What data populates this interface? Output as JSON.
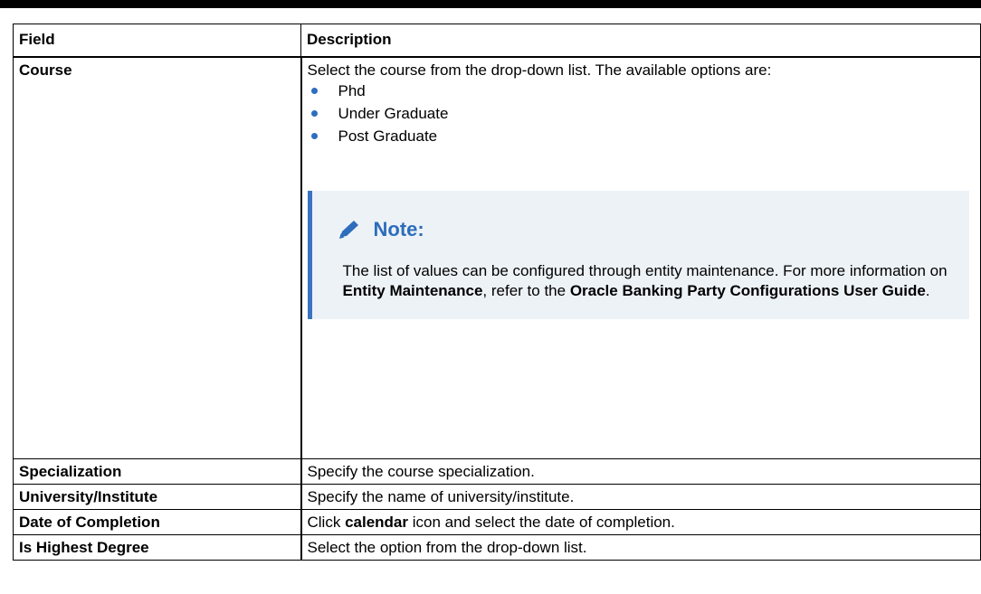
{
  "table": {
    "headers": [
      "Field",
      "Description"
    ],
    "rows": [
      {
        "field": "Course",
        "intro": "Select the course from the drop-down list. The available options are:",
        "options": [
          "Phd",
          "Under Graduate",
          "Post Graduate"
        ],
        "note": {
          "title": "Note:",
          "text1": "The list of values can be configured through entity maintenance. For more information on ",
          "bold1": "Entity Maintenance",
          "text2": ", refer to the ",
          "bold2": "Oracle Banking Party Configurations User Guide",
          "text3": "."
        }
      },
      {
        "field": "Specialization",
        "description": "Specify the course specialization."
      },
      {
        "field": "University/Institute",
        "description": "Specify the name of university/institute."
      },
      {
        "field": "Date of Completion",
        "pre": "Click ",
        "bold": "calendar",
        "post": " icon and select the date of completion."
      },
      {
        "field": "Is Highest Degree",
        "description": "Select the option from the drop-down list."
      }
    ]
  },
  "colors": {
    "bullet": "#2e6dbf",
    "note_title": "#2d6dbb",
    "note_bg": "#edf2f7",
    "note_bar": "#3b73c1"
  },
  "icons": {
    "note": "pencil-icon",
    "bullet": "bullet-dot-icon"
  }
}
